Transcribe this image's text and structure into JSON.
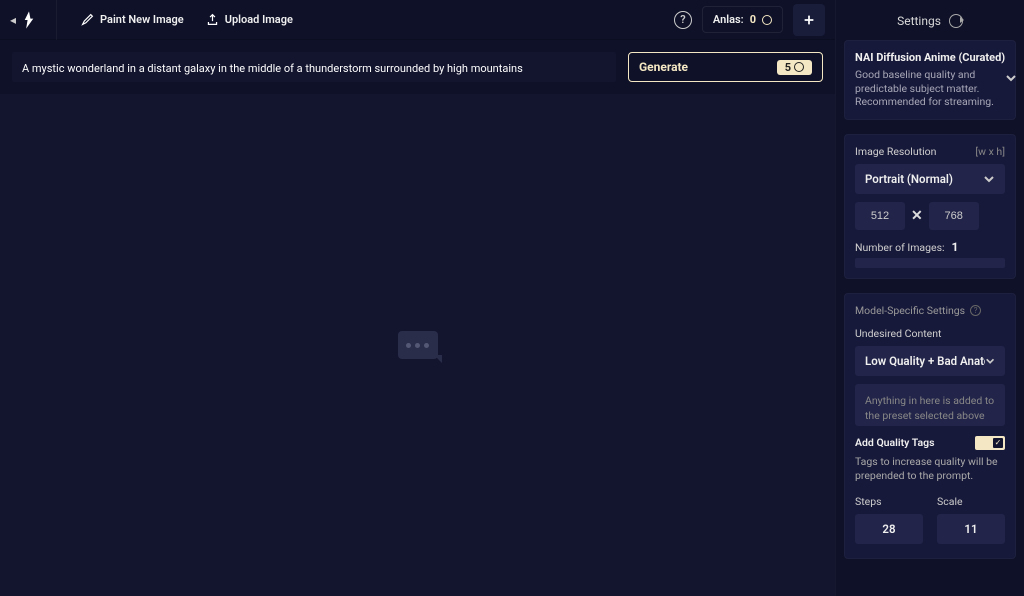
{
  "topbar": {
    "paint_label": "Paint New Image",
    "upload_label": "Upload Image",
    "anlas_label": "Anlas:",
    "anlas_value": "0"
  },
  "prompt": {
    "value": "A mystic wonderland in a distant galaxy in the middle of a thunderstorm surrounded by high mountains",
    "generate_label": "Generate",
    "generate_cost": "5"
  },
  "sidebar": {
    "settings_label": "Settings",
    "model": {
      "title": "NAI Diffusion Anime (Curated)",
      "desc": "Good baseline quality and predictable subject matter. Recommended for streaming."
    },
    "resolution": {
      "label": "Image Resolution",
      "hint": "[w x h]",
      "select": "Portrait (Normal)",
      "width": "512",
      "height": "768"
    },
    "num_images": {
      "label": "Number of Images:",
      "value": "1"
    },
    "model_specific_label": "Model-Specific Settings",
    "undesired": {
      "label": "Undesired Content",
      "select": "Low Quality + Bad Anatomy",
      "placeholder": "Anything in here is added to the preset selected above"
    },
    "quality_tags": {
      "label": "Add Quality Tags",
      "desc": "Tags to increase quality will be prepended to the prompt."
    },
    "steps": {
      "label": "Steps",
      "value": "28"
    },
    "scale": {
      "label": "Scale",
      "value": "11"
    }
  }
}
